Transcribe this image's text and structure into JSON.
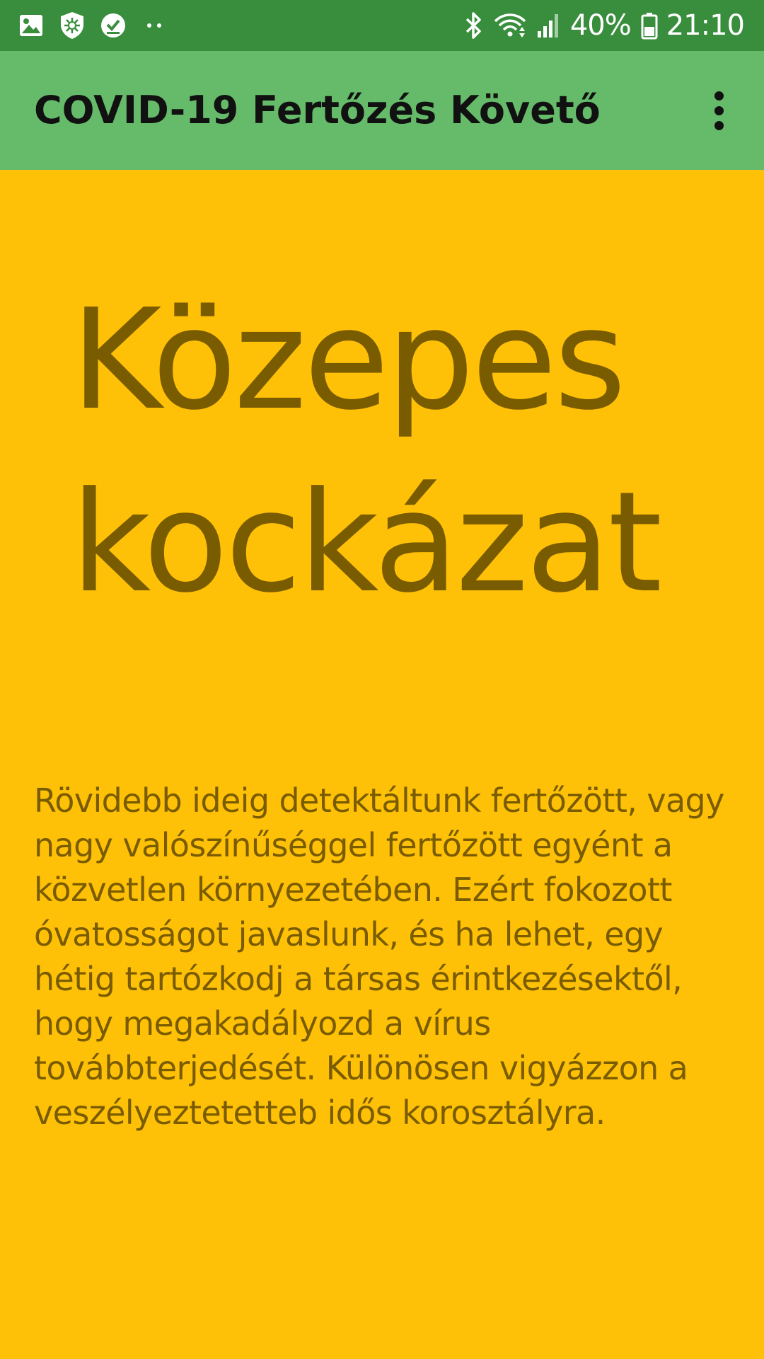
{
  "status_bar": {
    "battery_percent": "40%",
    "time": "21:10",
    "left_icons": [
      "image-icon",
      "shield-virus-icon",
      "check-circle-icon",
      "more-dots-icon"
    ],
    "right_icons": [
      "bluetooth-icon",
      "wifi-icon",
      "signal-icon",
      "battery-icon"
    ],
    "background_color": "#388E3C"
  },
  "app_bar": {
    "title": "COVID-19 Fertőzés Követő",
    "menu_icon": "overflow-menu-icon",
    "background_color": "#66BB6A"
  },
  "main": {
    "background_color": "#FFC107",
    "text_color": "#7A5C00",
    "risk_title": "Közepes kockázat",
    "risk_description": "Rövidebb ideig detektáltunk fertőzött, vagy nagy valószínűséggel fertőzött egyént a közvetlen környezetében. Ezért fokozott óvatosságot javaslunk, és ha lehet, egy hétig tartózkodj a társas érintkezésektől, hogy megakadályozd a vírus továbbterjedését. Különösen vigyázzon a veszélyeztetetteb idős korosztályra."
  }
}
